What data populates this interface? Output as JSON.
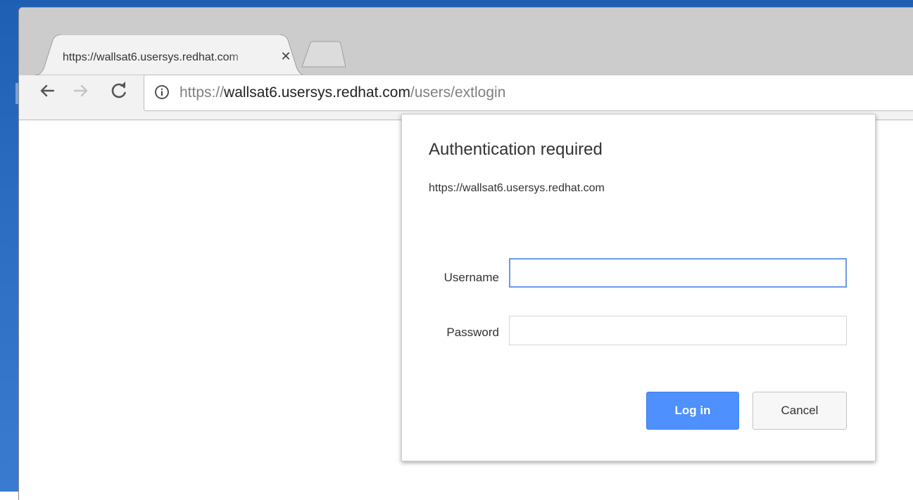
{
  "browser": {
    "tab": {
      "title": "https://wallsat6.usersys.redhat.com",
      "close_glyph": "✕",
      "close_icon": "close-icon"
    },
    "new_tab_icon": "new-tab-icon",
    "nav": {
      "back_icon": "back-arrow-icon",
      "forward_icon": "forward-arrow-icon",
      "reload_icon": "reload-icon"
    },
    "omnibox": {
      "info_icon": "info-icon",
      "scheme": "https://",
      "host": "wallsat6.usersys.redhat.com",
      "path": "/users/extlogin"
    }
  },
  "auth_dialog": {
    "title": "Authentication required",
    "origin": "https://wallsat6.usersys.redhat.com",
    "username_label": "Username",
    "username_value": "",
    "password_label": "Password",
    "password_value": "",
    "login_label": "Log in",
    "cancel_label": "Cancel"
  },
  "colors": {
    "accent": "#4d90fe",
    "focus_border": "#6b9ae6",
    "desktop": "#2b6cc0"
  }
}
